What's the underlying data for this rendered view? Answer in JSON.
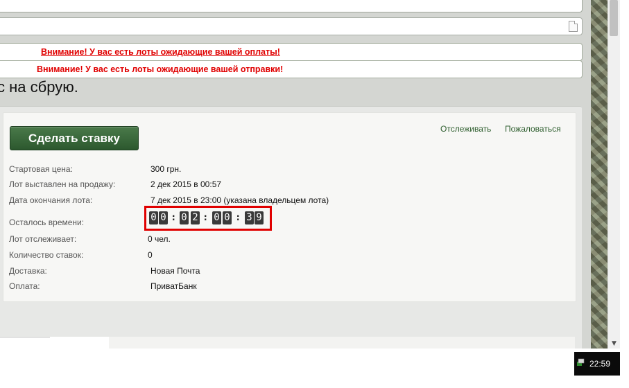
{
  "alerts": {
    "payment": "Внимание! У вас есть лоты ожидающие вашей оплаты!",
    "shipping": "Внимание! У вас есть лоты ожидающие вашей отправки!"
  },
  "lot": {
    "title_fragment": "с на сбрую."
  },
  "actions": {
    "bid_button": "Сделать ставку",
    "watch": "Отслеживать",
    "report": "Пожаловаться"
  },
  "details": {
    "start_price": {
      "label": "Стартовая цена:",
      "value": "300 грн."
    },
    "listed": {
      "label": "Лот выставлен на продажу:",
      "value": "2 дек 2015 в 00:57"
    },
    "end_date": {
      "label": "Дата окончания лота:",
      "value": "7 дек 2015 в 23:00 (указана владельцем лота)"
    },
    "time_left": {
      "label": "Осталось времени:"
    },
    "watchers": {
      "label": "Лот отслеживает:",
      "value": "0 чел."
    },
    "bids": {
      "label": "Количество ставок:",
      "value": "0"
    },
    "delivery": {
      "label": "Доставка:",
      "value": "Новая Почта"
    },
    "payment": {
      "label": "Оплата:",
      "value": "ПриватБанк"
    }
  },
  "countdown": {
    "digits": [
      "0",
      "0",
      "0",
      "2",
      "0",
      "0",
      "3",
      "9"
    ]
  },
  "taskbar": {
    "clock": "22:59"
  },
  "colors": {
    "alert_red": "#e00000",
    "button_green": "#2c582e",
    "link_green": "#2e5e2e",
    "highlight_box": "#e00000"
  },
  "icons": {
    "document": "document-icon",
    "scroll_down": "scroll-down-arrow-icon",
    "tray": "network-tray-icon"
  }
}
